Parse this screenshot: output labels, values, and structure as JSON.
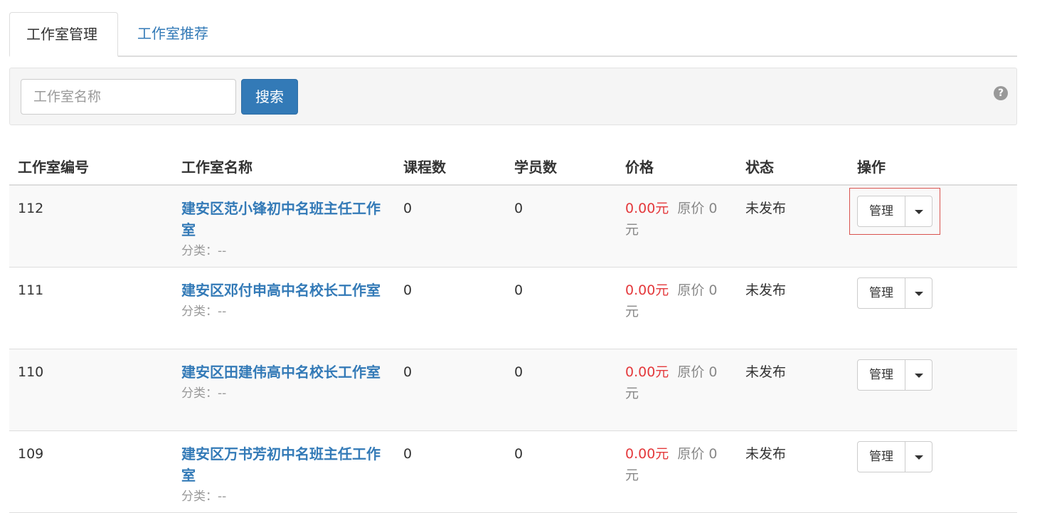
{
  "tabs": [
    {
      "label": "工作室管理",
      "active": true
    },
    {
      "label": "工作室推荐",
      "active": false
    }
  ],
  "search": {
    "placeholder": "工作室名称",
    "button_label": "搜索",
    "help_icon": "question-circle-icon",
    "help_glyph": "?"
  },
  "table": {
    "headers": [
      "工作室编号",
      "工作室名称",
      "课程数",
      "学员数",
      "价格",
      "状态",
      "操作"
    ],
    "rows": [
      {
        "id": "112",
        "name": "建安区范小锋初中名班主任工作室",
        "category": "分类：--",
        "courses": "0",
        "students": "0",
        "price": "0.00元",
        "orig_price": "原价 0 元",
        "status": "未发布",
        "manage_label": "管理"
      },
      {
        "id": "111",
        "name": "建安区邓付申高中名校长工作室",
        "category": "分类：--",
        "courses": "0",
        "students": "0",
        "price": "0.00元",
        "orig_price": "原价 0 元",
        "status": "未发布",
        "manage_label": "管理"
      },
      {
        "id": "110",
        "name": "建安区田建伟高中名校长工作室",
        "category": "分类：--",
        "courses": "0",
        "students": "0",
        "price": "0.00元",
        "orig_price": "原价 0 元",
        "status": "未发布",
        "manage_label": "管理"
      },
      {
        "id": "109",
        "name": "建安区万书芳初中名班主任工作室",
        "category": "分类：--",
        "courses": "0",
        "students": "0",
        "price": "0.00元",
        "orig_price": "原价 0 元",
        "status": "未发布",
        "manage_label": "管理"
      }
    ]
  },
  "colors": {
    "link": "#337ab7",
    "price": "#e4393c",
    "primary_button": "#337ab7",
    "highlight_outline": "#d9534f"
  }
}
